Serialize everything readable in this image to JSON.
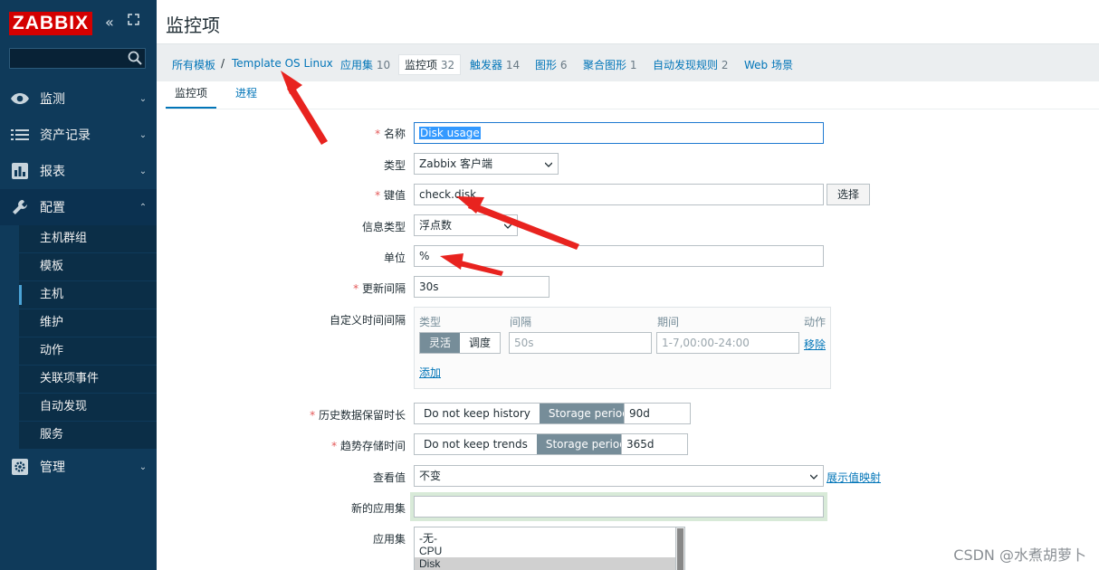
{
  "sidebar": {
    "logo": "ZABBIX",
    "collapse_glyph": "«",
    "kiosk_glyph": "⛶",
    "nav": [
      {
        "label": "监测",
        "icon": "eye-icon"
      },
      {
        "label": "资产记录",
        "icon": "list-icon"
      },
      {
        "label": "报表",
        "icon": "bar-chart-icon"
      },
      {
        "label": "配置",
        "icon": "wrench-icon"
      },
      {
        "label": "管理",
        "icon": "gear-icon"
      }
    ],
    "submenu": [
      "主机群组",
      "模板",
      "主机",
      "维护",
      "动作",
      "关联项事件",
      "自动发现",
      "服务"
    ],
    "submenu_selected": "主机"
  },
  "page_title": "监控项",
  "breadcrumb": {
    "all_templates": "所有模板",
    "separator": "/",
    "template": "Template OS Linux",
    "items": [
      {
        "label": "应用集",
        "count": "10"
      },
      {
        "label": "监控项",
        "count": "32"
      },
      {
        "label": "触发器",
        "count": "14"
      },
      {
        "label": "图形",
        "count": "6"
      },
      {
        "label": "聚合图形",
        "count": "1"
      },
      {
        "label": "自动发现规则",
        "count": "2"
      },
      {
        "label": "Web 场景",
        "count": ""
      }
    ]
  },
  "tabs": [
    "监控项",
    "进程"
  ],
  "form": {
    "name_label": "名称",
    "name_value": "Disk usage",
    "type_label": "类型",
    "type_value": "Zabbix 客户端",
    "key_label": "键值",
    "key_value": "check.disk",
    "select_button": "选择",
    "info_type_label": "信息类型",
    "info_type_value": "浮点数",
    "units_label": "单位",
    "units_value": "%",
    "interval_label": "更新间隔",
    "interval_value": "30s",
    "custom_label": "自定义时间间隔",
    "custom": {
      "col_type": "类型",
      "col_interval": "间隔",
      "col_period": "期间",
      "col_action": "动作",
      "flexible": "灵活",
      "scheduling": "调度",
      "interval_placeholder": "50s",
      "period_placeholder": "1-7,00:00-24:00",
      "remove": "移除",
      "add": "添加"
    },
    "history_label": "历史数据保留时长",
    "history_off": "Do not keep history",
    "history_on": "Storage period",
    "history_value": "90d",
    "trends_label": "趋势存储时间",
    "trends_off": "Do not keep trends",
    "trends_on": "Storage period",
    "trends_value": "365d",
    "show_value_label": "查看值",
    "show_value": "不变",
    "show_value_map": "展示值映射",
    "new_app_label": "新的应用集",
    "new_app_value": "",
    "apps_label": "应用集",
    "apps": [
      "-无-",
      "CPU",
      "Disk"
    ],
    "apps_selected": "Disk"
  },
  "watermark": "CSDN @水煮胡萝卜",
  "colors": {
    "sidebar": "#0f3a5a",
    "logo": "#d40000",
    "link": "#0275b8",
    "required": "#e45959",
    "annotation_arrow": "#e8231f"
  }
}
